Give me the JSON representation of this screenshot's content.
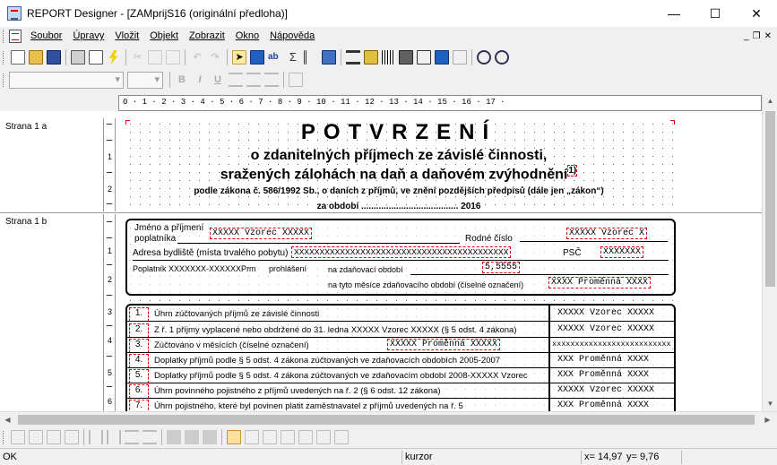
{
  "window": {
    "title": "REPORT Designer - [ZAMprijS16 (originální předloha)]",
    "minimize": "—",
    "maximize": "☐",
    "close": "✕"
  },
  "menu": {
    "items": [
      "Soubor",
      "Úpravy",
      "Vložit",
      "Objekt",
      "Zobrazit",
      "Okno",
      "Nápověda"
    ],
    "mdi": [
      "_",
      "❐",
      "✕"
    ]
  },
  "format": {
    "bold": "B",
    "italic": "I",
    "underline": "U"
  },
  "ruler": {
    "text": "0 · 1 · 2 · 3 · 4 · 5 · 6 · 7 · 8 · 9 · 10 · 11 · 12 · 13 · 14 · 15 · 16 · 17 ·"
  },
  "sections": {
    "a": "Strana 1 a",
    "b": "Strana 1 b"
  },
  "vruler": {
    "a": [
      "1",
      "2"
    ],
    "b": [
      "1",
      "2",
      "3",
      "4",
      "5",
      "6"
    ]
  },
  "header": {
    "title": "POTVRZENÍ",
    "line1": "o zdanitelných příjmech ze závislé činnosti,",
    "line2": "sražených zálohách na daň a daňovém zvýhodnění",
    "footnote_mark": "1)",
    "law": "podle zákona č. 586/1992 Sb., o daních z příjmů, ve znění pozdějších předpisů (dále jen „zákon“)",
    "period": "za období ....................................... 2016"
  },
  "person": {
    "name_label": "Jméno a příjmení",
    "payer_label": "poplatníka",
    "name_value": "XXXXX Vzorec XXXXX",
    "rc_label": "Rodné číslo",
    "rc_value": "XXXXX Vzorec X",
    "address_label": "Adresa bydliště (místa trvalého pobytu)",
    "address_value": "XXXXXXXXXXXXXXXXXXXXXXXXXXXXXXXXXXXXXXXXXX",
    "psc_label": "PSČ",
    "psc_value": "XXXXXXX",
    "signed_label": "Poplatník XXXXXXX-XXXXXXPrm",
    "signed_suffix": "prohlášení",
    "period_label": "na zdaňovací období",
    "period_value": "5,5555",
    "months_label": "na tyto měsíce zdaňovacího období (číselné označení)",
    "months_value": "XXXX Proměnná XXXX"
  },
  "rows": [
    {
      "num": "1.",
      "text": "Úhrn zúčtovaných příjmů ze závislé činnosti",
      "value": "XXXXX Vzorec XXXXX"
    },
    {
      "num": "2.",
      "text": "Z ř. 1 příjmy vyplacené nebo obdržené do 31. ledna XXXXX Vzorec XXXXX (§ 5 odst. 4 zákona)",
      "value": "XXXXX Vzorec XXXXX"
    },
    {
      "num": "3.",
      "text": "Zúčtováno v měsících (číselné označení)",
      "mid": "XXXXX Proměnná XXXXX",
      "value": "xxxxxxxxxxxxxxxxxxxxxxxxxx"
    },
    {
      "num": "4.",
      "text": "Doplatky příjmů podle § 5 odst. 4 zákona zúčtovaných ve zdaňovacích obdobích 2005-2007",
      "value": "XXX Proměnná XXXX"
    },
    {
      "num": "5.",
      "text": "Doplatky příjmů podle § 5 odst. 4 zákona zúčtovaných ve zdaňovacím období 2008-XXXXX Vzorec",
      "value": "XXX Proměnná XXXX"
    },
    {
      "num": "6.",
      "text": "Úhrn povinného pojistného z příjmů uvedených na ř. 2 (§ 6 odst. 12 zákona)",
      "value": "XXXXX Vzorec XXXXX"
    },
    {
      "num": "7.",
      "text": "Úhrn pojistného, které byl povinen platit zaměstnavatel z příjmů uvedených na ř. 5",
      "value": "XXX Proměnná XXXX"
    }
  ],
  "status": {
    "left": "OK",
    "mode": "kurzor",
    "x": "x= 14,97",
    "y": "y= 9,76"
  }
}
